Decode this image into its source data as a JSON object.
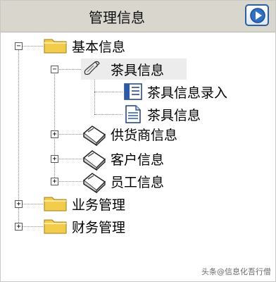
{
  "header": {
    "title": "管理信息",
    "nav_icon": "circle-arrow-right-icon"
  },
  "tree": {
    "root": {
      "label": "基本信息",
      "expanded": "−"
    },
    "tea_group": {
      "label": "茶具信息",
      "expanded": "−"
    },
    "tea_entry": {
      "label": "茶具信息录入"
    },
    "tea_info": {
      "label": "茶具信息"
    },
    "supplier": {
      "label": "供货商信息",
      "toggle": "+"
    },
    "customer": {
      "label": "客户信息",
      "toggle": "+"
    },
    "employee": {
      "label": "员工信息",
      "toggle": "+"
    },
    "business": {
      "label": "业务管理",
      "toggle": "+"
    },
    "finance": {
      "label": "财务管理",
      "toggle": "+"
    }
  },
  "watermark": "头条@信息化吾行僧",
  "colors": {
    "header_bg": "#d9d6ce",
    "folder_yellow": "#f2cc4a",
    "accent_blue": "#2f5fa3"
  }
}
